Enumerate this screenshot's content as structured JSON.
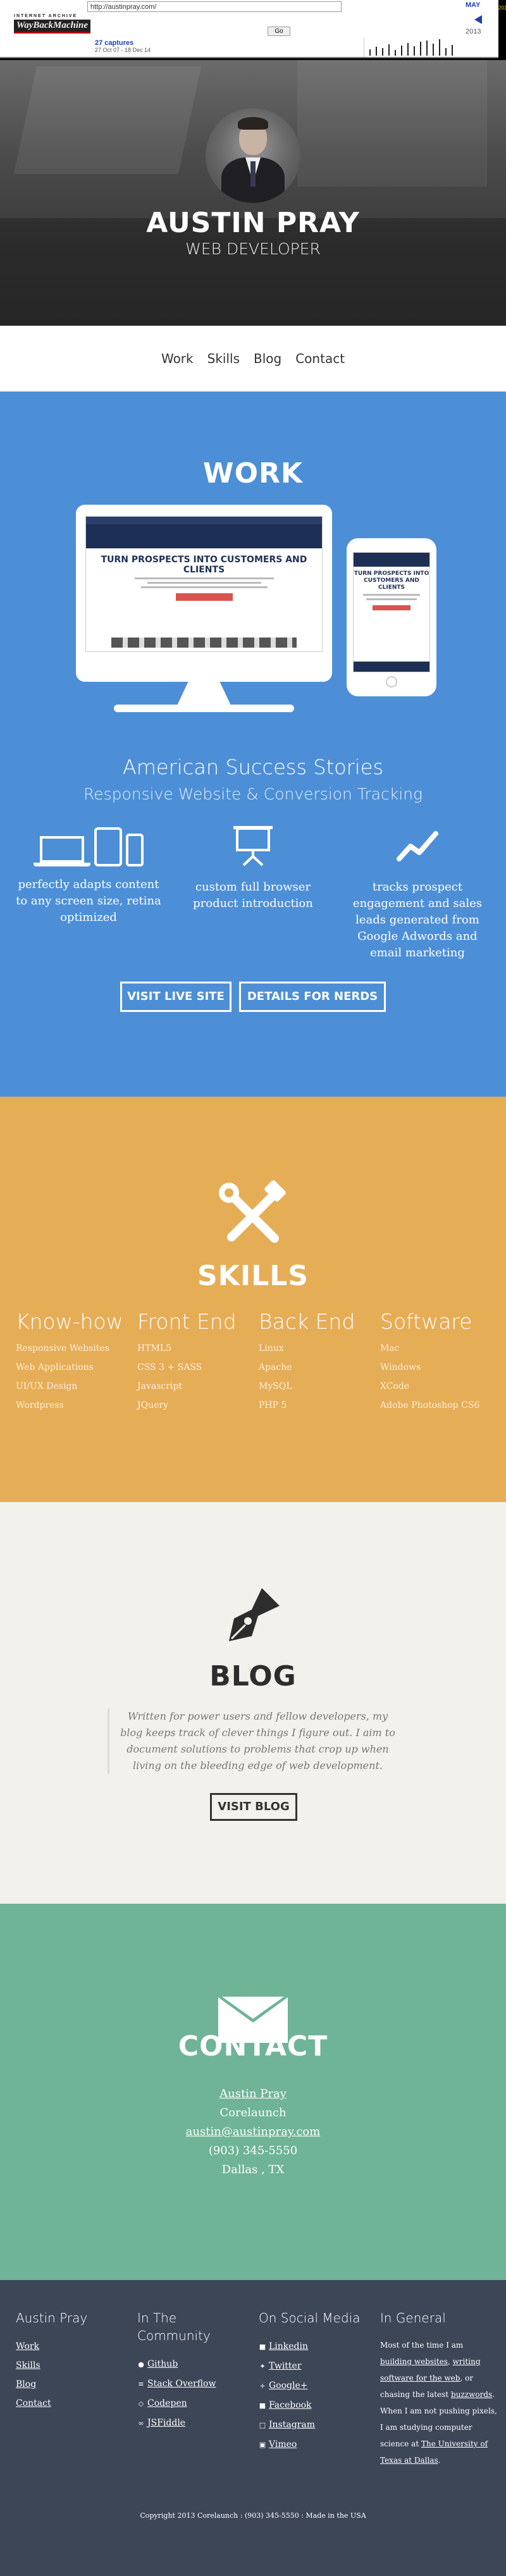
{
  "wayback": {
    "logo_line1": "INTERNET ARCHIVE",
    "logo_line2": "WayBackMachine",
    "url": "http://austinpray.com/",
    "go_label": "Go",
    "captures_count": "27 captures",
    "captures_range": "27 Oct 07 - 18 Dec 14",
    "month": "MAY",
    "year": "2013",
    "spark_heights": [
      10,
      14,
      12,
      18,
      9,
      16,
      20,
      15,
      22,
      24,
      19,
      26,
      12,
      17
    ]
  },
  "hero": {
    "name": "AUSTIN PRAY",
    "subtitle": "WEB DEVELOPER"
  },
  "nav": {
    "items": [
      "Work",
      "Skills",
      "Blog",
      "Contact"
    ]
  },
  "work": {
    "title": "WORK",
    "client": "American Success Stories",
    "subtitle": "Responsive Website & Conversion Tracking",
    "mock_headline": "TURN PROSPECTS INTO CUSTOMERS AND CLIENTS",
    "features": [
      {
        "icon": "devices-icon",
        "text": "perfectly adapts content to any screen size, retina optimized"
      },
      {
        "icon": "presentation-icon",
        "text": "custom full browser product introduction"
      },
      {
        "icon": "trend-line-icon",
        "text": "tracks prospect engagement and sales leads generated from Google Adwords and email marketing"
      }
    ],
    "buttons": {
      "live_site": "VISIT LIVE SITE",
      "details": "DETAILS FOR NERDS"
    }
  },
  "skills": {
    "title": "SKILLS",
    "columns": [
      {
        "heading": "Know-how",
        "items": [
          "Responsive Websites",
          "Web Applications",
          "UI/UX Design",
          "Wordpress"
        ]
      },
      {
        "heading": "Front End",
        "items": [
          "HTML5",
          "CSS 3 + SASS",
          "Javascript",
          "JQuery"
        ]
      },
      {
        "heading": "Back End",
        "items": [
          "Linux",
          "Apache",
          "MySQL",
          "PHP 5"
        ]
      },
      {
        "heading": "Software",
        "items": [
          "Mac",
          "Windows",
          "XCode",
          "Adobe Photoshop CS6"
        ]
      }
    ]
  },
  "blog": {
    "title": "BLOG",
    "text": "Written for power users and fellow developers, my blog keeps track of clever things I figure out. I aim to document solutions to problems that crop up when living on the bleeding edge of web development.",
    "button": "VISIT BLOG"
  },
  "contact": {
    "title": "CONTACT",
    "name": "Austin Pray",
    "company": "Corelaunch",
    "email": "austin@austinpray.com",
    "phone": "(903) 345-5550",
    "location": "Dallas , TX"
  },
  "footer": {
    "col1": {
      "heading": "Austin Pray",
      "links": [
        "Work",
        "Skills",
        "Blog",
        "Contact"
      ]
    },
    "col2": {
      "heading": "In The Community",
      "links": [
        "Github",
        "Stack Overflow",
        "Codepen",
        "JSFiddle"
      ]
    },
    "col3": {
      "heading": "On Social Media",
      "links": [
        "Linkedin",
        "Twitter",
        "Google+",
        "Facebook",
        "Instagram",
        "Vimeo"
      ]
    },
    "col4": {
      "heading": "In General",
      "p1": "Most of the time I am",
      "link1": "building websites",
      "p2": ",",
      "link2": "writing software for the web",
      "p3": ", or chasing the latest",
      "link3": "buzzwords",
      "p4": ". When I am not pushing pixels, I am studying computer science at",
      "link4": "The University of Texas at Dallas",
      "p5": "."
    },
    "copyright": "Copyright 2013 Corelaunch : (903) 345-5550 : Made in the USA"
  },
  "colors": {
    "work_bg": "#4d8fd6",
    "skills_bg": "#e6ad57",
    "blog_bg": "#f3f1ec",
    "contact_bg": "#6fb497",
    "footer_bg": "#3d4657"
  }
}
